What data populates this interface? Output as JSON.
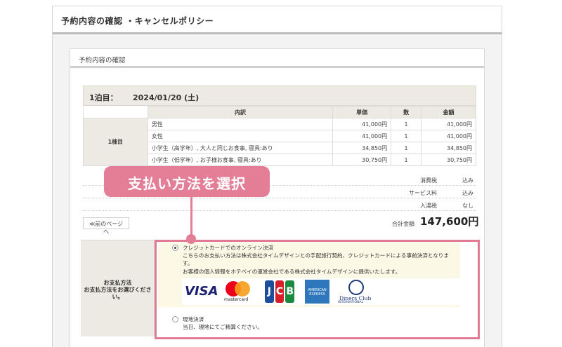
{
  "header": {
    "title": "予約内容の確認 ・キャンセルポリシー"
  },
  "section": {
    "title": "予約内容の確認"
  },
  "stay": {
    "night_label": "1泊目：",
    "date": "2024/01/20 (土)"
  },
  "table": {
    "headers": {
      "details": "内訳",
      "unit_price": "単価",
      "qty": "数",
      "amount": "金額"
    },
    "room_label": "1棟目",
    "rows": [
      {
        "label": "男性",
        "price": "41,000円",
        "qty": "1",
        "amount": "41,000円"
      },
      {
        "label": "女性",
        "price": "41,000円",
        "qty": "1",
        "amount": "41,000円"
      },
      {
        "label": "小学生（高学年）, 大人と同じお食事, 寝具:あり",
        "price": "34,850円",
        "qty": "1",
        "amount": "34,850円"
      },
      {
        "label": "小学生（低学年）, お子様お食事, 寝具:あり",
        "price": "30,750円",
        "qty": "1",
        "amount": "30,750円"
      }
    ]
  },
  "summary": {
    "consumption_tax": {
      "label": "消費税",
      "value": "込み"
    },
    "service_fee": {
      "label": "サービス料",
      "value": "込み"
    },
    "bath_tax": {
      "label": "入湯税",
      "value": "なし"
    }
  },
  "back_button": "≪前のページへ",
  "total": {
    "label": "合計金額",
    "value": "147,600円"
  },
  "payment": {
    "label_line1": "お支払方法",
    "label_line2": "お支払方法をお選びくださ",
    "label_line3": "い。",
    "option_credit": {
      "title": "クレジットカードでのオンライン決済",
      "desc1": "こちらのお支払い方法は株式会社タイムデザインとの手配旅行契約、クレジットカードによる事前決済となりま",
      "desc2": "す。",
      "desc3": "お客様の個人情報をホテペイの運営会社である株式会社タイムデザインに提供いたします。",
      "selected": true
    },
    "option_onsite": {
      "title": "現地決済",
      "desc": "当日、現地にてご精算ください。",
      "selected": false
    },
    "logos": {
      "visa": "VISA",
      "mastercard": "mastercard",
      "jcb": [
        "J",
        "C",
        "B"
      ],
      "amex_line1": "AMERICAN",
      "amex_line2": "EXPRESS",
      "diners_line1": "Diners Club",
      "diners_line2": "INTERNATIONAL"
    }
  },
  "callout": {
    "text": "支払い方法を選択",
    "color": "#e47e97"
  }
}
